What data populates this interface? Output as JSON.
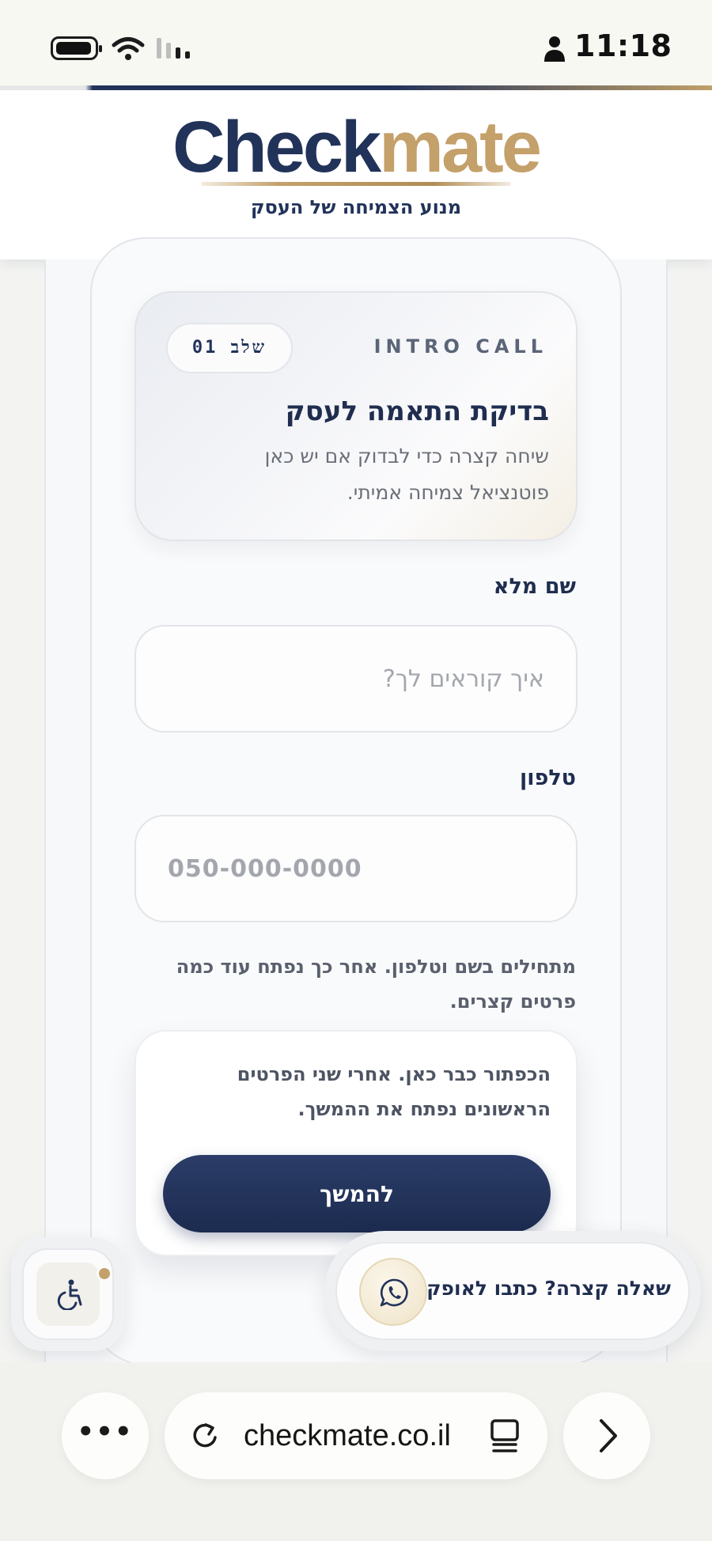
{
  "status_bar": {
    "time": "11:18",
    "icons": [
      "battery-icon",
      "wifi-icon",
      "cellular-signal-icon",
      "person-icon"
    ]
  },
  "header": {
    "logo_part1": "Check",
    "logo_part2": "mate",
    "tagline": "מנוע הצמיחה של העסק"
  },
  "step_card": {
    "step": "שלב 01",
    "label": "INTRO CALL",
    "title": "בדיקת התאמה לעסק",
    "description": "שיחה קצרה כדי לבדוק אם יש כאן פוטנציאל צמיחה אמיתי."
  },
  "form": {
    "name_label": "שם מלא",
    "name_placeholder": "איך קוראים לך?",
    "name_value": "",
    "phone_label": "טלפון",
    "phone_placeholder": "050-000-0000",
    "phone_value": "",
    "hint": "מתחילים בשם וטלפון. אחר כך נפתח עוד כמה פרטים קצרים."
  },
  "continue_card": {
    "text": "הכפתור כבר כאן. אחרי שני הפרטים הראשונים נפתח את ההמשך.",
    "button_label": "להמשך"
  },
  "floating": {
    "whatsapp_text": "שאלה קצרה? כתבו לאופק",
    "whatsapp_icon": "whatsapp-icon",
    "accessibility_icon": "accessibility-icon"
  },
  "browser": {
    "url": "checkmate.co.il",
    "more_label": "•••"
  },
  "colors": {
    "navy": "#1f2d4f",
    "gold": "#c4a06a",
    "background": "#f3f4f2"
  }
}
